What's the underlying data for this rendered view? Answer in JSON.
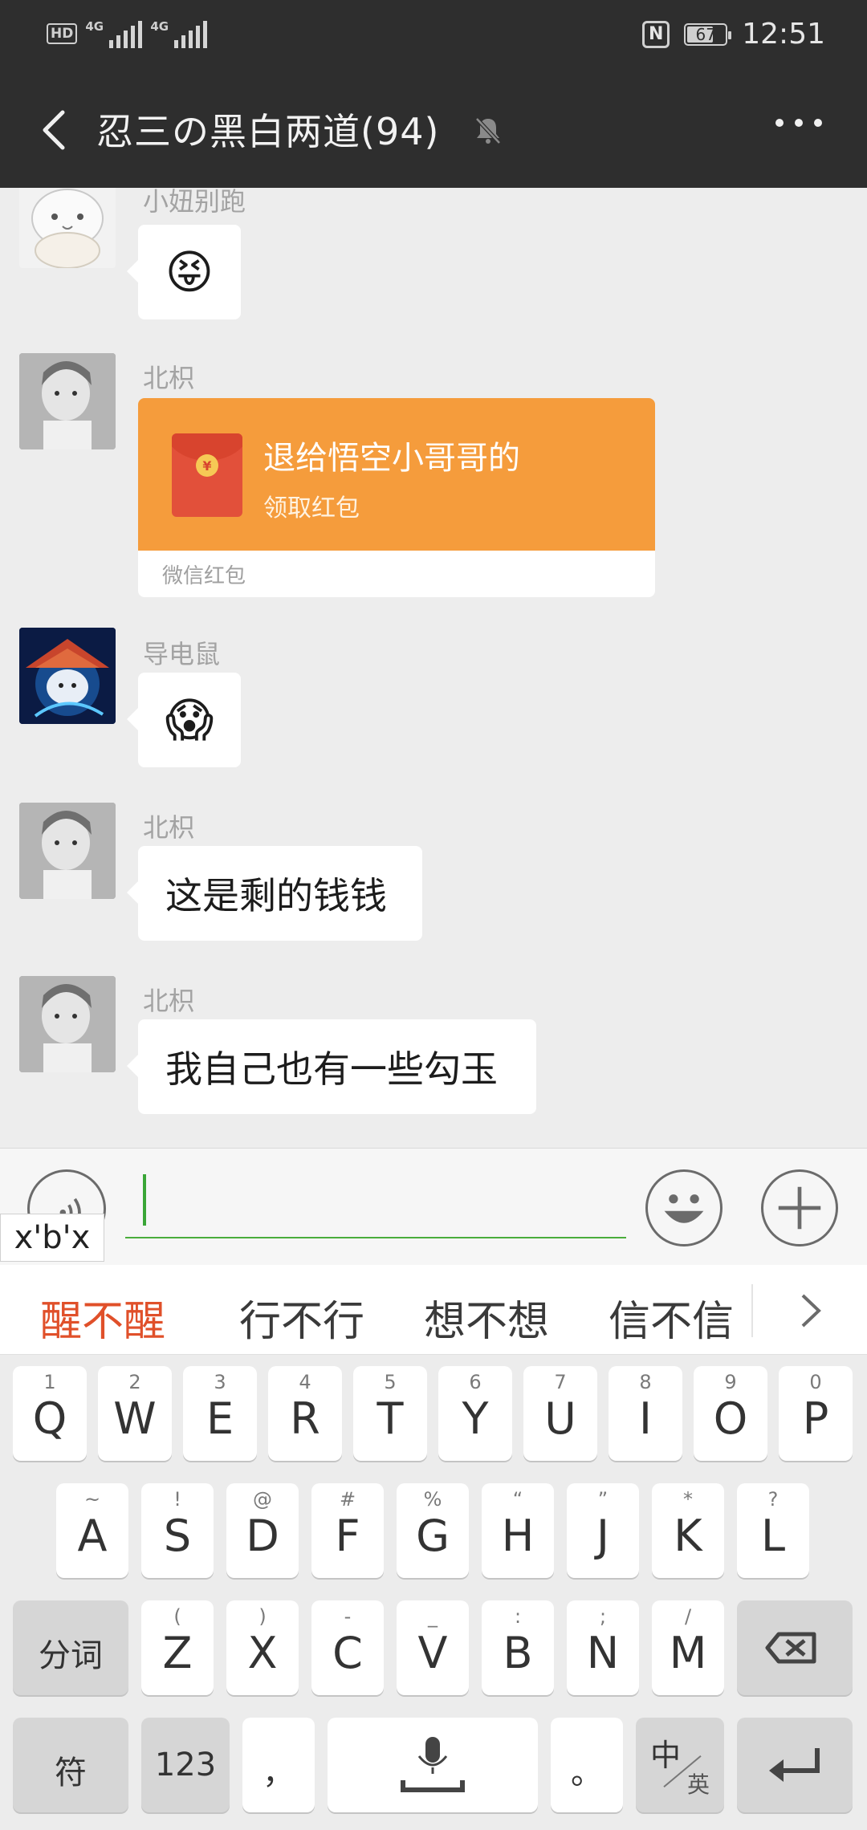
{
  "status_bar": {
    "hd": "HD",
    "net1": "4G",
    "net2": "4G",
    "nfc": "N",
    "battery": "67",
    "time": "12:51"
  },
  "header": {
    "title": "忍三の黑白两道(94)"
  },
  "messages": [
    {
      "sender": "小妞别跑",
      "type": "emoji",
      "content": "😝"
    },
    {
      "sender": "北枳",
      "type": "red_packet",
      "title": "退给悟空小哥哥的",
      "subtitle": "领取红包",
      "footer": "微信红包",
      "coin": "¥"
    },
    {
      "sender": "导电鼠",
      "type": "emoji",
      "content": "😱"
    },
    {
      "sender": "北枳",
      "type": "text",
      "content": "这是剩的钱钱"
    },
    {
      "sender": "北枳",
      "type": "text",
      "content": "我自己也有一些勾玉"
    }
  ],
  "input": {
    "value": "",
    "pinyin": "x'b'x"
  },
  "candidates": [
    "醒不醒",
    "行不行",
    "想不想",
    "信不信"
  ],
  "keyboard": {
    "row1": [
      {
        "key": "Q",
        "sub": "1"
      },
      {
        "key": "W",
        "sub": "2"
      },
      {
        "key": "E",
        "sub": "3"
      },
      {
        "key": "R",
        "sub": "4"
      },
      {
        "key": "T",
        "sub": "5"
      },
      {
        "key": "Y",
        "sub": "6"
      },
      {
        "key": "U",
        "sub": "7"
      },
      {
        "key": "I",
        "sub": "8"
      },
      {
        "key": "O",
        "sub": "9"
      },
      {
        "key": "P",
        "sub": "0"
      }
    ],
    "row2": [
      {
        "key": "A",
        "sub": "~"
      },
      {
        "key": "S",
        "sub": "!"
      },
      {
        "key": "D",
        "sub": "@"
      },
      {
        "key": "F",
        "sub": "#"
      },
      {
        "key": "G",
        "sub": "%"
      },
      {
        "key": "H",
        "sub": "“"
      },
      {
        "key": "J",
        "sub": "”"
      },
      {
        "key": "K",
        "sub": "*"
      },
      {
        "key": "L",
        "sub": "?"
      }
    ],
    "row3": [
      {
        "key": "Z",
        "sub": "("
      },
      {
        "key": "X",
        "sub": ")"
      },
      {
        "key": "C",
        "sub": "-"
      },
      {
        "key": "V",
        "sub": "_"
      },
      {
        "key": "B",
        "sub": ":"
      },
      {
        "key": "N",
        "sub": ";"
      },
      {
        "key": "M",
        "sub": "/"
      }
    ],
    "segment": "分词",
    "symbols": "符",
    "numbers": "123",
    "comma": "，",
    "period": "。",
    "lang_zh": "中",
    "lang_en": "英"
  },
  "colors": {
    "header_bg": "#2e2e2e",
    "chat_bg": "#ededed",
    "red_packet": "#f59c3c",
    "candidate_highlight": "#e0502a",
    "input_underline": "#4aad3c"
  }
}
